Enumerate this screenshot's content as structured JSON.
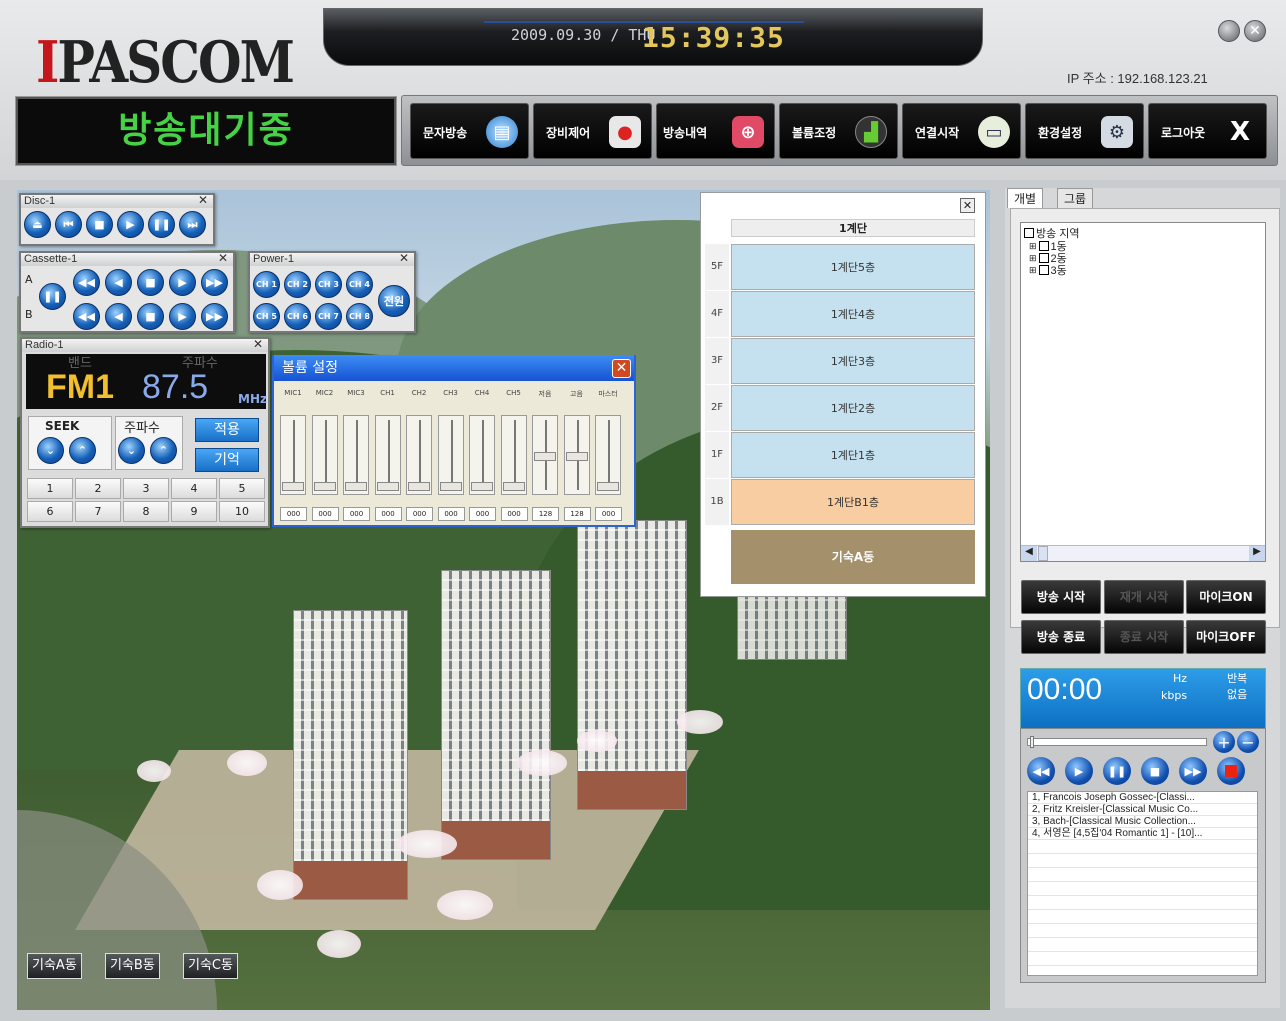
{
  "header": {
    "logo": "IPASCOM",
    "date": "2009.09.30 / THU",
    "time": "15:39:35",
    "ip": "IP 주소 : 192.168.123.21",
    "status": "방송대기중"
  },
  "toolbar": [
    {
      "label": "문자방송",
      "icon": "message-icon"
    },
    {
      "label": "장비제어",
      "icon": "joystick-icon"
    },
    {
      "label": "방송내역",
      "icon": "target-icon"
    },
    {
      "label": "볼륨조정",
      "icon": "signal-bars-icon"
    },
    {
      "label": "연결시작",
      "icon": "connect-icon"
    },
    {
      "label": "환경설정",
      "icon": "settings-icon"
    },
    {
      "label": "로그아웃",
      "icon": "close-x-icon"
    }
  ],
  "disc": {
    "title": "Disc-1"
  },
  "cassette": {
    "title": "Cassette-1",
    "rowA": "A",
    "rowB": "B"
  },
  "power": {
    "title": "Power-1",
    "channels": [
      "CH 1",
      "CH 2",
      "CH 3",
      "CH 4",
      "CH 5",
      "CH 6",
      "CH 7",
      "CH 8"
    ],
    "power_label": "전원"
  },
  "radio": {
    "title": "Radio-1",
    "band_label": "밴드",
    "freq_label": "주파수",
    "band": "FM1",
    "freq": "87.5",
    "unit": "MHz",
    "seek": "SEEK",
    "tune": "주파수",
    "apply": "적용",
    "memory": "기억",
    "presets": [
      "1",
      "2",
      "3",
      "4",
      "5",
      "6",
      "7",
      "8",
      "9",
      "10"
    ]
  },
  "volume": {
    "title": "볼륨 설정",
    "channels": [
      "MIC1",
      "MIC2",
      "MIC3",
      "CH1",
      "CH2",
      "CH3",
      "CH4",
      "CH5",
      "저음",
      "고음",
      "마스터"
    ],
    "values": [
      "000",
      "000",
      "000",
      "000",
      "000",
      "000",
      "000",
      "000",
      "128",
      "128",
      "000"
    ],
    "levels": [
      0,
      0,
      0,
      0,
      0,
      0,
      0,
      0,
      50,
      50,
      0
    ]
  },
  "floors": {
    "header": "1계단",
    "rows": [
      {
        "label": "5F",
        "name": "1계단5층"
      },
      {
        "label": "4F",
        "name": "1계단4층"
      },
      {
        "label": "3F",
        "name": "1계단3층"
      },
      {
        "label": "2F",
        "name": "1계단2층"
      },
      {
        "label": "1F",
        "name": "1계단1층"
      },
      {
        "label": "1B",
        "name": "1계단B1층"
      }
    ],
    "building": "기숙A동"
  },
  "scene_buttons": [
    "기숙A동",
    "기숙B동",
    "기숙C동"
  ],
  "right": {
    "tabs": [
      "개별",
      "그룹"
    ],
    "tree_root": "방송 지역",
    "tree_items": [
      "1동",
      "2동",
      "3동"
    ],
    "btn_start": "방송 시작",
    "btn_pause": "재개 시작",
    "btn_micon": "마이크ON",
    "btn_stop": "방송 종료",
    "btn_resume": "종료 시작",
    "btn_micoff": "마이크OFF",
    "timer": "00:00",
    "hz": "Hz",
    "kbps": "kbps",
    "repeat_label": "반복",
    "repeat_value": "없음",
    "playlist": [
      "1, Francois Joseph Gossec-[Classi...",
      "2, Fritz Kreisler-[Classical Music Co...",
      "3, Bach-[Classical Music Collection...",
      "4, 서영은 [4,5집'04 Romantic 1] - [10]..."
    ]
  }
}
